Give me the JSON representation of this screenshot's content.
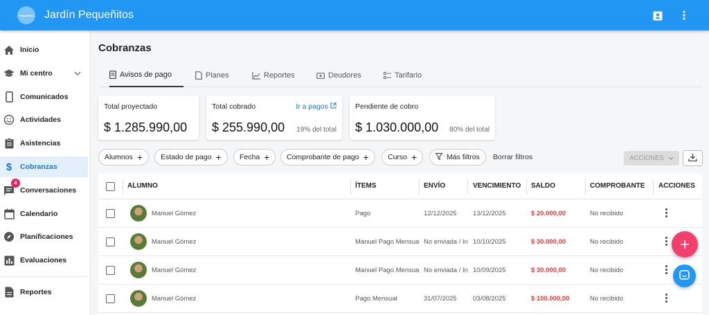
{
  "app": {
    "title": "Jardín Pequeñitos",
    "logo_text": "Pequeñitos"
  },
  "sidebar": {
    "items": [
      {
        "label": "Inicio",
        "icon": "home-icon"
      },
      {
        "label": "Mi centro",
        "icon": "school-icon"
      },
      {
        "label": "Comunicados",
        "icon": "phone-icon"
      },
      {
        "label": "Actividades",
        "icon": "smile-icon"
      },
      {
        "label": "Asistencias",
        "icon": "clipboard-icon"
      },
      {
        "label": "Cobranzas",
        "icon": "dollar-icon"
      },
      {
        "label": "Conversaciones",
        "icon": "chat-icon",
        "badge": "4"
      },
      {
        "label": "Calendario",
        "icon": "calendar-icon"
      },
      {
        "label": "Planificaciones",
        "icon": "compass-icon"
      },
      {
        "label": "Evaluaciones",
        "icon": "bar-chart-icon"
      },
      {
        "label": "Reportes",
        "icon": "report-icon"
      }
    ]
  },
  "page": {
    "title": "Cobranzas"
  },
  "tabs": [
    {
      "label": "Avisos de pago"
    },
    {
      "label": "Planes"
    },
    {
      "label": "Reportes"
    },
    {
      "label": "Deudores"
    },
    {
      "label": "Tarifario"
    }
  ],
  "summary": {
    "projected": {
      "label": "Total proyectado",
      "value": "$ 1.285.990,00"
    },
    "collected": {
      "label": "Total cobrado",
      "value": "$ 255.990,00",
      "pct": "19% del total",
      "link": "Ir a pagos"
    },
    "pending": {
      "label": "Pendiente de cobro",
      "value": "$ 1.030.000,00",
      "pct": "80% del total"
    }
  },
  "filters": {
    "chips": [
      "Alumnos",
      "Estado de pago",
      "Fecha",
      "Comprobante de pago",
      "Curso"
    ],
    "more": "Más filtros",
    "clear": "Borrar filtros",
    "actions": "ACCIONES"
  },
  "table": {
    "headers": [
      "ALUMNO",
      "ÍTEMS",
      "ENVÍO",
      "VENCIMIENTO",
      "SALDO",
      "COMPROBANTE",
      "ACCIONES"
    ],
    "rows": [
      {
        "student": "Manuel Gómez",
        "items": "Pago",
        "sent": "12/12/2025",
        "due": "13/12/2025",
        "balance": "$ 20.000,00",
        "receipt": "No recibido"
      },
      {
        "student": "Manuel Gómez",
        "items": "Manuel Pago Mensual",
        "sent": "No enviada / In",
        "due": "10/10/2025",
        "balance": "$ 30.000,00",
        "receipt": "No recibido"
      },
      {
        "student": "Manuel Gómez",
        "items": "Manuel Pago Mensual",
        "sent": "No enviada / In",
        "due": "10/09/2025",
        "balance": "$ 30.000,00",
        "receipt": "No recibido"
      },
      {
        "student": "Manuel Gómez",
        "items": "Pago Mensual",
        "sent": "31/07/2025",
        "due": "03/08/2025",
        "balance": "$ 100.000,00",
        "receipt": "No recibido"
      }
    ]
  },
  "colors": {
    "primary": "#2196f3",
    "fab": "#f23f6e",
    "balance": "#e53935"
  }
}
